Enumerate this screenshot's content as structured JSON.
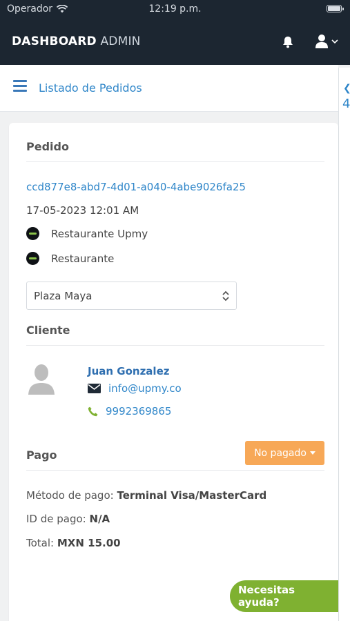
{
  "status_bar": {
    "carrier": "Operador",
    "time": "12:19 p.m."
  },
  "header": {
    "brand_bold": "DASHBOARD",
    "brand_light": "ADMIN"
  },
  "breadcrumb": {
    "title": "Listado de Pedidos"
  },
  "right_strip": {
    "digit": "4"
  },
  "order": {
    "section_title": "Pedido",
    "id": "ccd877e8-abd7-4d01-a040-4abe9026fa25",
    "date": "17-05-2023 12:01 AM",
    "restaurants": [
      "Restaurante Upmy",
      "Restaurante"
    ],
    "branch_selected": "Plaza Maya"
  },
  "client": {
    "section_title": "Cliente",
    "name": "Juan Gonzalez",
    "email": "info@upmy.co",
    "phone": "9992369865"
  },
  "payment": {
    "section_title": "Pago",
    "status_button": "No pagado",
    "method_label": "Método de pago:",
    "method_value": "Terminal Visa/MasterCard",
    "id_label": "ID de pago:",
    "id_value": "N/A",
    "total_label": "Total:",
    "total_value": "MXN 15.00"
  },
  "help": {
    "label": "Necesitas ayuda?"
  },
  "colors": {
    "header_bg": "#1c2631",
    "link": "#2f86c9",
    "unpaid": "#f7a857",
    "help": "#7fb131"
  }
}
